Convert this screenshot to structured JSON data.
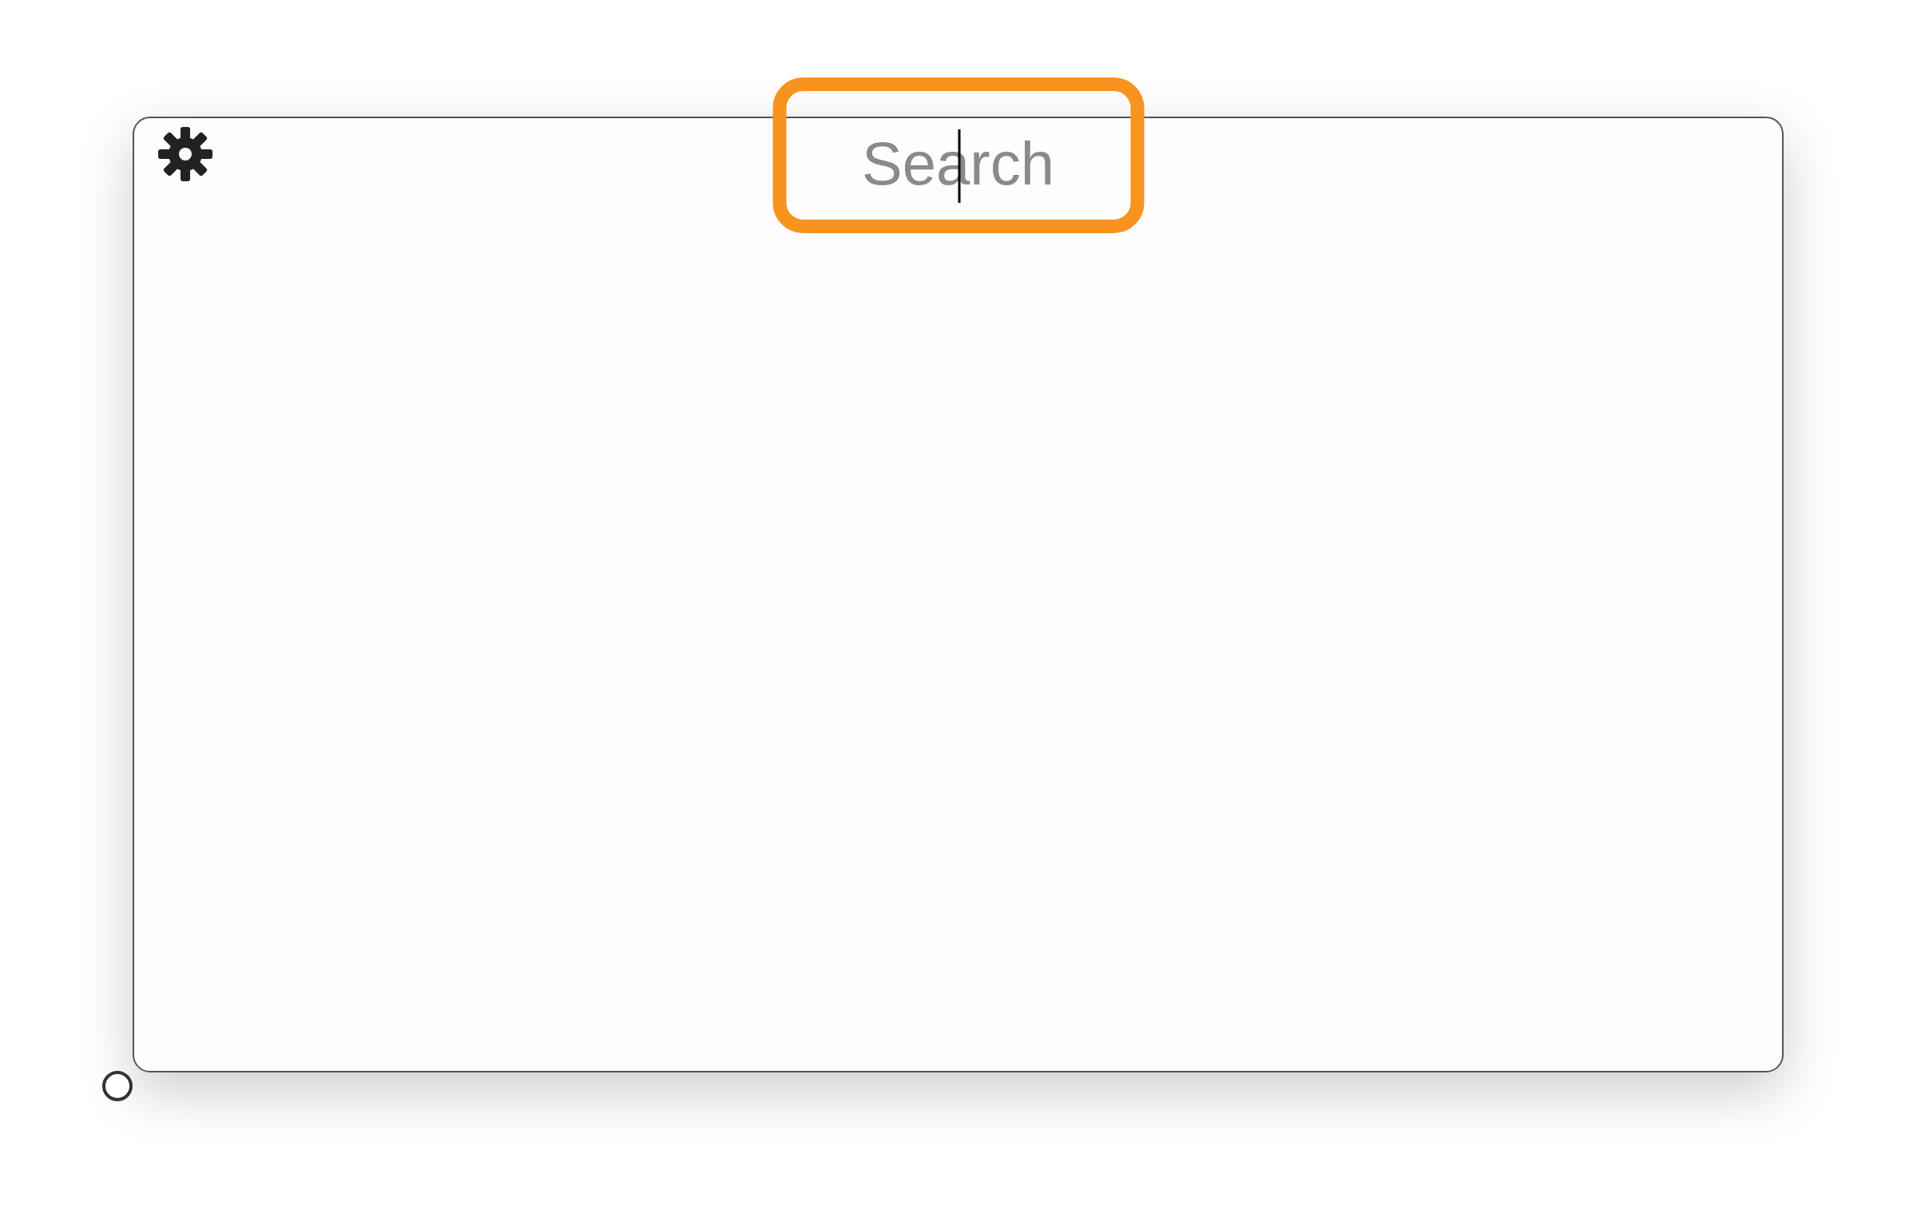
{
  "search": {
    "placeholder": "Search",
    "focused": true,
    "highlighted": true
  }
}
